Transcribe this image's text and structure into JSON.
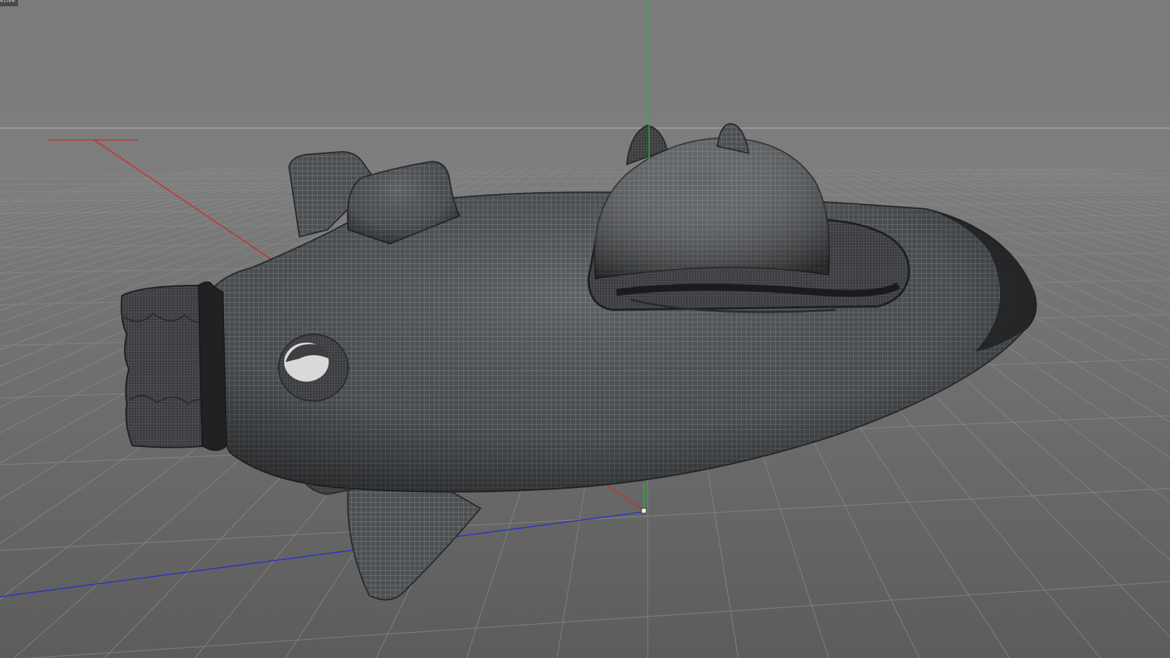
{
  "viewport": {
    "label": "ktive",
    "axis_colors": {
      "x": "#c63030",
      "y": "#1fb82a",
      "z": "#2a33c8"
    },
    "background_top": "#7c7c7c",
    "floor_color": "#636363",
    "grid_color": "#8a8a8a",
    "mesh_color": "#4a4d50",
    "object_icon": "spaceship-mesh-icon"
  }
}
